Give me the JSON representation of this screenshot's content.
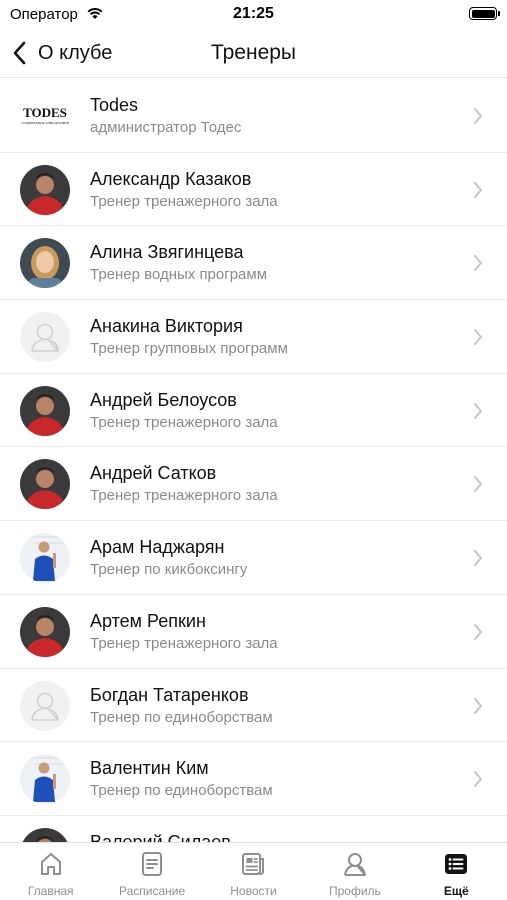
{
  "status_bar": {
    "carrier": "Оператор",
    "time": "21:25"
  },
  "nav": {
    "back_label": "О клубе",
    "title": "Тренеры"
  },
  "trainers": [
    {
      "name": "Todes",
      "role": "администратор Тодес",
      "avatar": "todes-logo",
      "logo_text": "TODES",
      "logo_subtext": "СТУДИЯ БАЛЕТА АЛЛЫ ДУХОВОЙ"
    },
    {
      "name": "Александр Казаков",
      "role": "Тренер тренажерного зала",
      "avatar": "photo-red-shirt"
    },
    {
      "name": "Алина Звягинцева",
      "role": "Тренер водных программ",
      "avatar": "photo-blonde"
    },
    {
      "name": "Анакина Виктория",
      "role": "Тренер групповых программ",
      "avatar": "placeholder-user-icon"
    },
    {
      "name": "Андрей Белоусов",
      "role": "Тренер тренажерного зала",
      "avatar": "photo-red-shirt"
    },
    {
      "name": "Андрей Сатков",
      "role": "Тренер тренажерного зала",
      "avatar": "photo-red-shirt"
    },
    {
      "name": "Арам Наджарян",
      "role": "Тренер по кикбоксингу",
      "avatar": "photo-blue-fighter"
    },
    {
      "name": "Артем Репкин",
      "role": "Тренер тренажерного зала",
      "avatar": "photo-red-shirt"
    },
    {
      "name": "Богдан Татаренков",
      "role": "Тренер по единоборствам",
      "avatar": "placeholder-user-icon"
    },
    {
      "name": "Валентин Ким",
      "role": "Тренер по единоборствам",
      "avatar": "photo-blue-fighter"
    },
    {
      "name": "Валерий Силаев",
      "role": "",
      "avatar": "photo-red-shirt"
    }
  ],
  "tabs": [
    {
      "label": "Главная",
      "icon": "home-icon"
    },
    {
      "label": "Расписание",
      "icon": "schedule-icon"
    },
    {
      "label": "Новости",
      "icon": "news-icon"
    },
    {
      "label": "Профиль",
      "icon": "profile-icon"
    },
    {
      "label": "Ещё",
      "icon": "more-list-icon",
      "active": true
    }
  ],
  "colors": {
    "text": "#111111",
    "secondary_text": "#8a8a8a",
    "separator": "#ececec",
    "tab_inactive": "#8e8e8e",
    "avatar_red": "#c8282a",
    "avatar_blue": "#1f4fb8"
  }
}
